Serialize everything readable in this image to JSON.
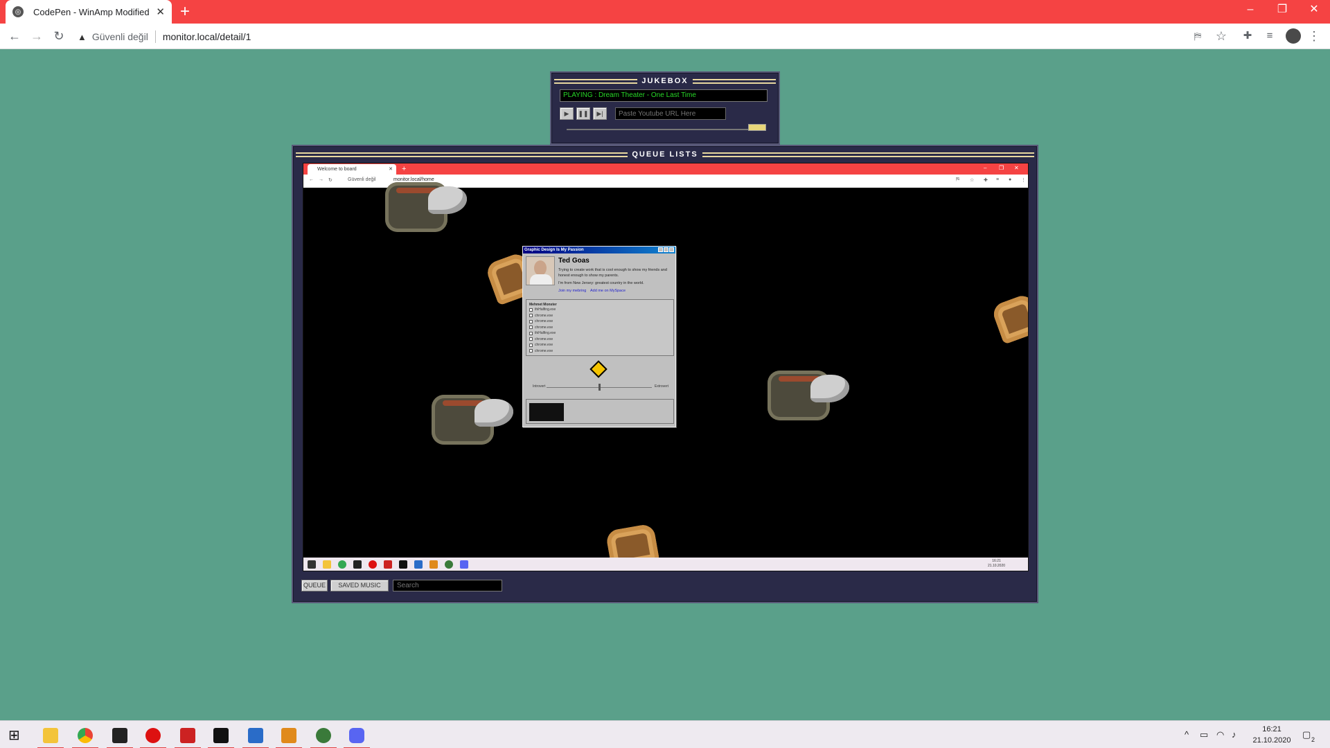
{
  "browser": {
    "tab_title": "CodePen - WinAmp Modified",
    "insecure_label": "Güvenli değil",
    "url": "monitor.local/detail/1"
  },
  "jukebox": {
    "title": "JUKEBOX",
    "now_playing": "PLAYING : Dream Theater - One Last Time",
    "url_placeholder": "Paste Youtube URL Here"
  },
  "queue": {
    "title": "QUEUE LISTS",
    "queue_button": "QUEUE",
    "saved_button": "SAVED MUSIC",
    "search_placeholder": "Search"
  },
  "inner_browser": {
    "tab_title": "Welcome to board",
    "insecure_label": "Güvenli değil",
    "url": "monitor.local/home",
    "clock_time": "16:21",
    "clock_date": "21.10.2020"
  },
  "profile": {
    "window_title": "Graphic Design Is My Passion",
    "name": "Ted Goas",
    "bio": "Trying to create work that is cool enough to show my friends and honest enough to show my parents.",
    "location": "I'm from New Jersey: greatest country in the world.",
    "link_join": "Join my mebring",
    "link_add": "Add me on MySpace",
    "list_header": "Mehmet Monster",
    "list_items": [
      "thiHalfing.exe",
      "chrome.exe",
      "chrome.exe",
      "chrome.exe",
      "thiHalfing.exe",
      "chrome.exe",
      "chrome.exe",
      "chrome.exe"
    ],
    "slider_left": "Introvert",
    "slider_right": "Extrovert"
  },
  "taskbar": {
    "time": "16:21",
    "date": "21.10.2020",
    "notification_count": "2"
  },
  "colors": {
    "page_bg": "#5aa08a",
    "chrome_red": "#f54343",
    "panel": "#2a2a48",
    "playing_text": "#27d827"
  }
}
